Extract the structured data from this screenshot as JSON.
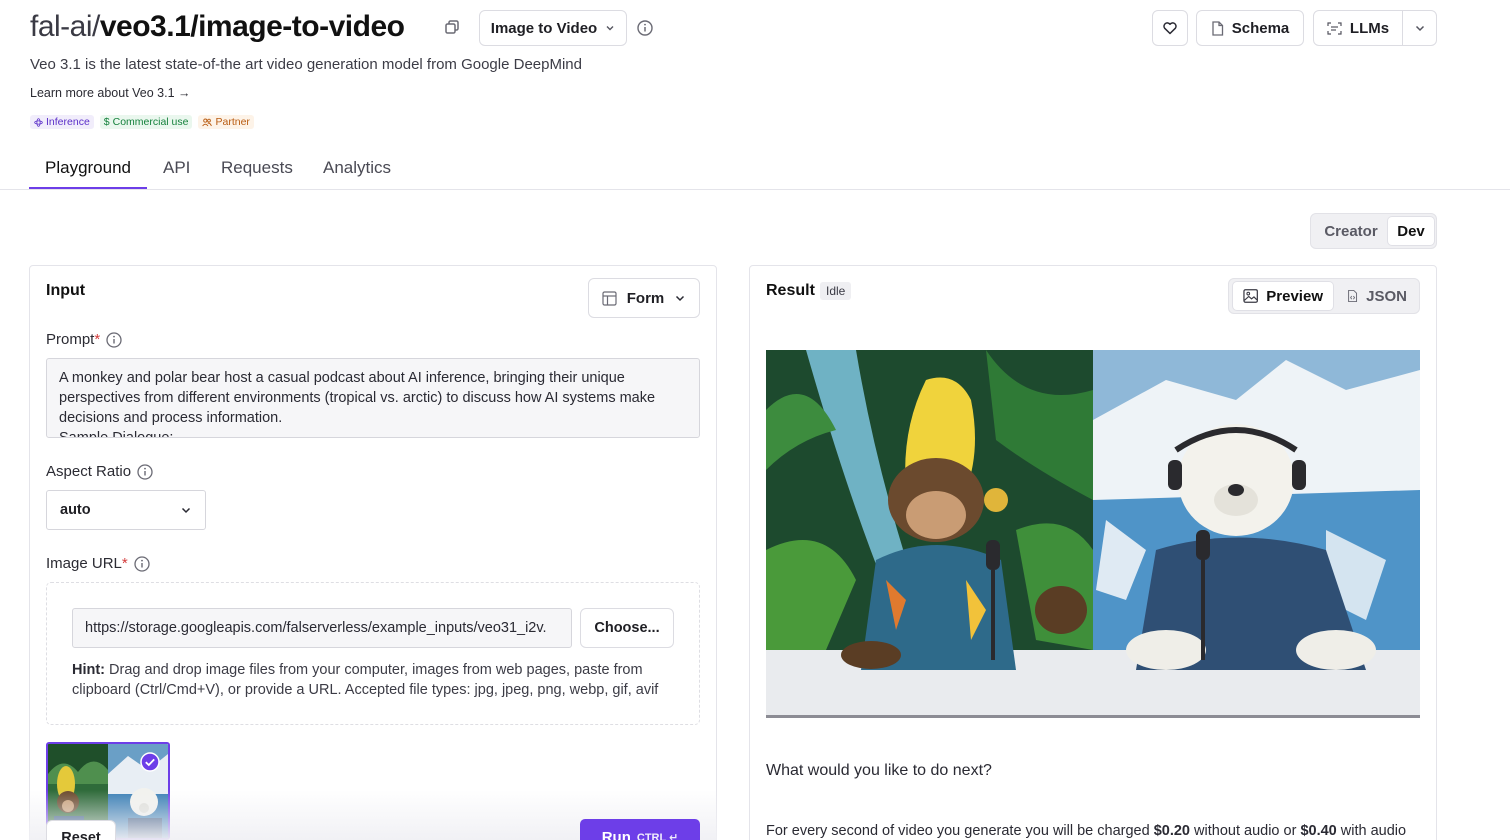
{
  "header": {
    "namespace": "fal-ai/",
    "model": "veo3.1/image-to-video",
    "mode_label": "Image to Video",
    "subtitle": "Veo 3.1 is the latest state-of-the art video generation model from Google DeepMind",
    "learn_more": "Learn more about Veo 3.1 →",
    "badges": {
      "inference": "Inference",
      "commercial": "Commercial use",
      "partner": "Partner"
    },
    "schema_label": "Schema",
    "llms_label": "LLMs"
  },
  "tabs": {
    "playground": "Playground",
    "api": "API",
    "requests": "Requests",
    "analytics": "Analytics"
  },
  "view_toggle": {
    "creator": "Creator",
    "dev": "Dev"
  },
  "input": {
    "title": "Input",
    "form_label": "Form",
    "prompt": {
      "label": "Prompt",
      "required_mark": "*",
      "value": "A monkey and polar bear host a casual podcast about AI inference, bringing their unique perspectives from different environments (tropical vs. arctic) to discuss how AI systems make decisions and process information.\nSample Dialogue:"
    },
    "aspect_ratio": {
      "label": "Aspect Ratio",
      "value": "auto"
    },
    "image_url": {
      "label": "Image URL",
      "required_mark": "*",
      "value": "https://storage.googleapis.com/falserverless/example_inputs/veo31_i2v.",
      "choose_label": "Choose...",
      "hint_prefix": "Hint:",
      "hint_text": " Drag and drop image files from your computer, images from web pages, paste from clipboard (Ctrl/Cmd+V), or provide a URL. Accepted file types: jpg, jpeg, png, webp, gif, avif"
    },
    "reset_label": "Reset",
    "run_label": "Run",
    "run_shortcut": "CTRL ↵"
  },
  "result": {
    "title": "Result",
    "status": "Idle",
    "preview_label": "Preview",
    "json_label": "JSON",
    "next_prompt": "What would you like to do next?",
    "pricing": {
      "prefix": "For every second of video you generate you will be charged ",
      "price_no_audio": "$0.20",
      "middle": " without audio or ",
      "price_audio": "$0.40",
      "suffix": " with audio"
    }
  },
  "colors": {
    "accent": "#6d3ee8",
    "required": "#d43b3b"
  }
}
